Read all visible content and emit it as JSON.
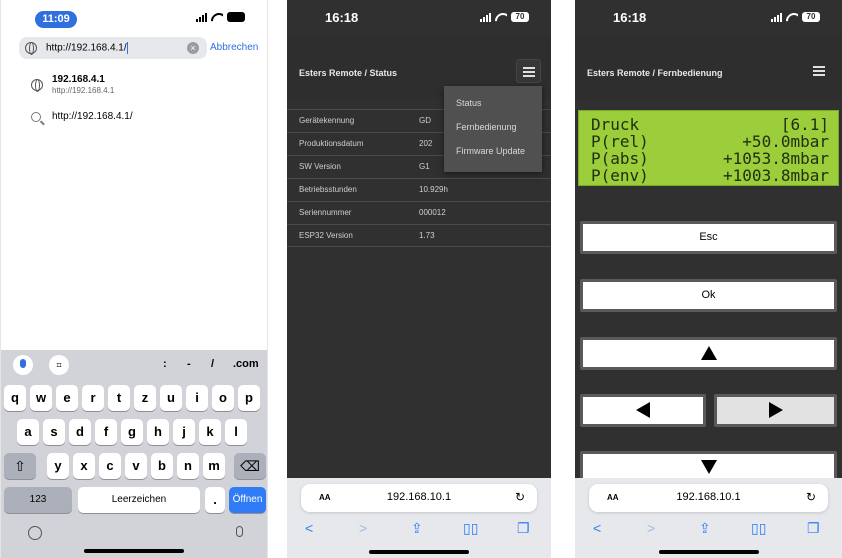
{
  "phone1": {
    "status": {
      "time": "11:09"
    },
    "urlbar": {
      "text": "http://192.168.4.1/",
      "clear_glyph": "×",
      "cancel_label": "Abbrechen"
    },
    "suggestions": [
      {
        "title": "192.168.4.1",
        "subtitle": "http://192.168.4.1",
        "icon": "globe-icon"
      },
      {
        "title": "http://192.168.4.1/",
        "icon": "search-icon"
      }
    ],
    "keyboard": {
      "top_symbols": [
        ":",
        "-",
        "/",
        ".com"
      ],
      "row1": [
        "q",
        "w",
        "e",
        "r",
        "t",
        "z",
        "u",
        "i",
        "o",
        "p"
      ],
      "row2": [
        "a",
        "s",
        "d",
        "f",
        "g",
        "h",
        "j",
        "k",
        "l"
      ],
      "row3": [
        "y",
        "x",
        "c",
        "v",
        "b",
        "n",
        "m"
      ],
      "shift": "⇧",
      "backspace": "⌫",
      "numbers_label": "123",
      "space_label": "Leerzeichen",
      "dot_label": ".",
      "open_label": "Öffnen"
    }
  },
  "phone2": {
    "status": {
      "time": "16:18",
      "battery": "70"
    },
    "header": {
      "title": "Esters Remote / Status"
    },
    "menu": {
      "items": [
        "Status",
        "Fernbedienung",
        "Firmware Update"
      ]
    },
    "table": [
      {
        "label": "Gerätekennung",
        "value": "GD"
      },
      {
        "label": "Produktionsdatum",
        "value": "202"
      },
      {
        "label": "SW Version",
        "value": "G1"
      },
      {
        "label": "Betriebsstunden",
        "value": "10.929h"
      },
      {
        "label": "Seriennummer",
        "value": "000012"
      },
      {
        "label": "ESP32 Version",
        "value": "1.73"
      }
    ],
    "safari": {
      "aa": "AA",
      "address": "192.168.10.1",
      "reload": "↻",
      "back": "<",
      "forward": ">"
    }
  },
  "phone3": {
    "status": {
      "time": "16:18",
      "battery": "70"
    },
    "header": {
      "title": "Esters Remote / Fernbedienung"
    },
    "lcd": [
      {
        "left": "Druck",
        "right": "[6.1]"
      },
      {
        "left": "P(rel)",
        "right": "+50.0mbar"
      },
      {
        "left": "P(abs)",
        "right": "+1053.8mbar"
      },
      {
        "left": "P(env)",
        "right": "+1003.8mbar"
      }
    ],
    "buttons": {
      "esc": "Esc",
      "ok": "Ok"
    },
    "safari": {
      "aa": "AA",
      "address": "192.168.10.1",
      "reload": "↻",
      "back": "<",
      "forward": ">"
    }
  },
  "colors": {
    "ios_blue": "#2f7cf6",
    "lcd_green": "#9ccd3a",
    "web_bg": "#303030",
    "keyboard_bg": "#d1d3d9"
  }
}
